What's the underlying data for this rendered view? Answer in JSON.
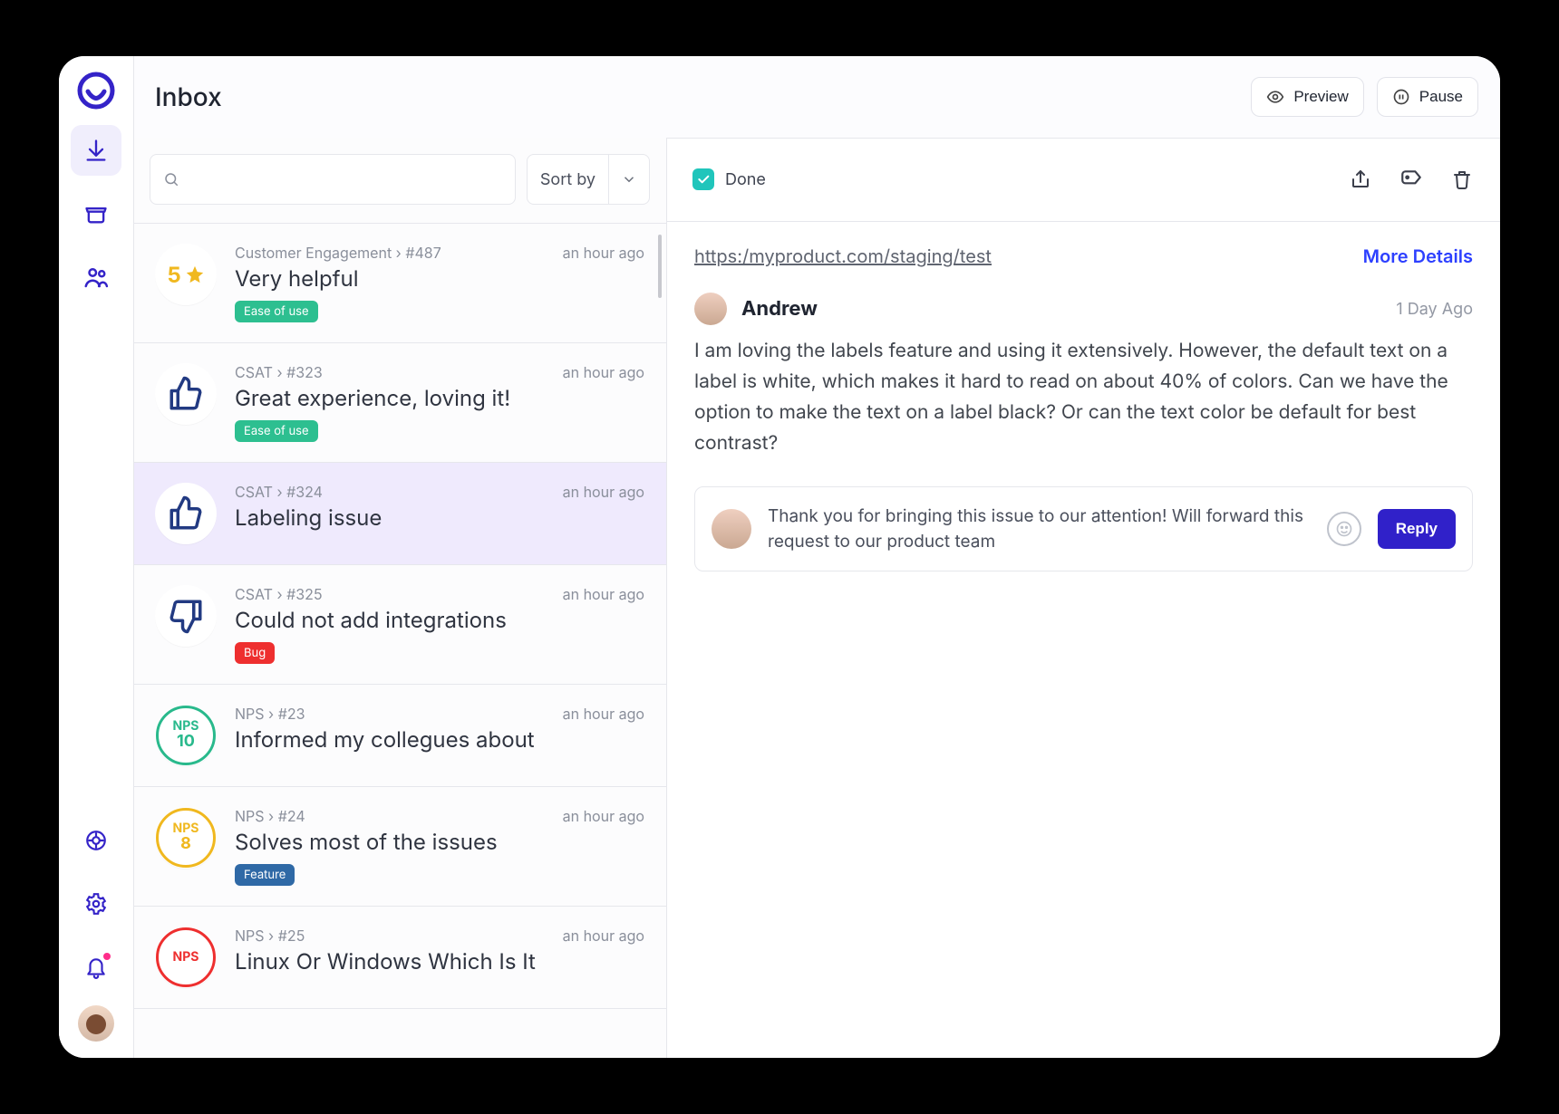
{
  "app": {
    "title": "Inbox"
  },
  "header": {
    "preview": "Preview",
    "pause": "Pause"
  },
  "listbar": {
    "sort_label": "Sort by",
    "search": ""
  },
  "items": [
    {
      "kind": "star",
      "value": "5",
      "source": "Customer Engagement › #487",
      "ago": "an hour ago",
      "subject": "Very helpful",
      "tag": {
        "label": "Ease of use",
        "color": "green"
      }
    },
    {
      "kind": "thumb-up",
      "source": "CSAT › #323",
      "ago": "an hour ago",
      "subject": "Great experience, loving it!",
      "tag": {
        "label": "Ease of use",
        "color": "green"
      }
    },
    {
      "kind": "thumb-up",
      "source": "CSAT › #324",
      "ago": "an hour ago",
      "subject": "Labeling issue",
      "selected": true
    },
    {
      "kind": "thumb-down",
      "source": "CSAT › #325",
      "ago": "an hour ago",
      "subject": "Could not add integrations",
      "tag": {
        "label": "Bug",
        "color": "red"
      }
    },
    {
      "kind": "nps",
      "nps": {
        "label": "NPS",
        "value": "10",
        "color": "green"
      },
      "source": "NPS › #23",
      "ago": "an hour ago",
      "subject": "Informed my collegues about"
    },
    {
      "kind": "nps",
      "nps": {
        "label": "NPS",
        "value": "8",
        "color": "amber"
      },
      "source": "NPS › #24",
      "ago": "an hour ago",
      "subject": "Solves most of the issues",
      "tag": {
        "label": "Feature",
        "color": "blue"
      }
    },
    {
      "kind": "nps",
      "nps": {
        "label": "NPS",
        "value": "",
        "color": "red"
      },
      "source": "NPS › #25",
      "ago": "an hour ago",
      "subject": "Linux Or Windows Which Is It"
    }
  ],
  "detail": {
    "done_label": "Done",
    "url": "https:/myproduct.com/staging/test",
    "more": "More Details",
    "author": "Andrew",
    "when": "1 Day Ago",
    "body": "I am loving the labels feature and using it extensively.  However, the default text on a label is white, which makes it hard to read on about 40% of colors.  Can we have the option to make the text on a label black?  Or can the text color be default for best contrast?",
    "reply_text": "Thank you for bringing this issue to our attention! Will forward this request to our product team",
    "reply_btn": "Reply"
  }
}
